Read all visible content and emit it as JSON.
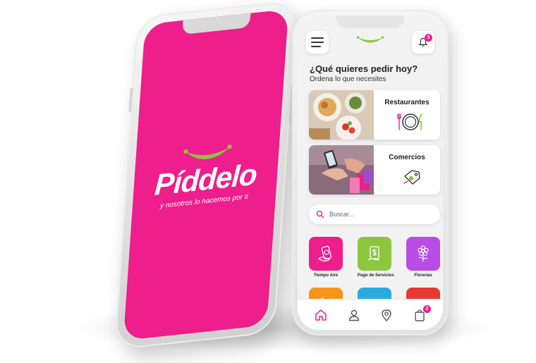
{
  "splash": {
    "brand_name": "Píddelo",
    "tagline": "y nosotros lo hacemos por ti",
    "colors": {
      "background": "#ee1e8c",
      "smile": "#8cc63f"
    }
  },
  "home": {
    "header": {
      "menu_icon": "hamburger-icon",
      "logo_icon": "smile-logo-icon",
      "notifications_icon": "bell-icon",
      "notifications_count": "3"
    },
    "heading": "¿Qué quieres pedir hoy?",
    "subheading": "Ordena lo que necesites",
    "categories": [
      {
        "label": "Restaurantes",
        "icon": "plate-cutlery-icon"
      },
      {
        "label": "Comercios",
        "icon": "price-tag-icon"
      }
    ],
    "search": {
      "placeholder": "Buscar..."
    },
    "services": [
      {
        "label": "Tiempo Aire",
        "icon": "phone-recharge-icon",
        "color": "#ee1e8c"
      },
      {
        "label": "Pago de Servicios",
        "icon": "bill-payment-icon",
        "color": "#8cc63f"
      },
      {
        "label": "Florerías",
        "icon": "flower-icon",
        "color": "#b84ce6"
      },
      {
        "label": "",
        "icon": "tools-icon",
        "color": "#f7941d"
      },
      {
        "label": "",
        "icon": "pill-icon",
        "color": "#29abe2"
      },
      {
        "label": "",
        "icon": "store-icon",
        "color": "#e53935"
      }
    ],
    "bottom_nav": [
      {
        "icon": "home-icon",
        "active": true
      },
      {
        "icon": "user-icon",
        "active": false
      },
      {
        "icon": "location-pin-icon",
        "active": false
      },
      {
        "icon": "shopping-bag-icon",
        "active": false,
        "badge": "2"
      }
    ],
    "colors": {
      "accent": "#ee1e8c"
    }
  }
}
